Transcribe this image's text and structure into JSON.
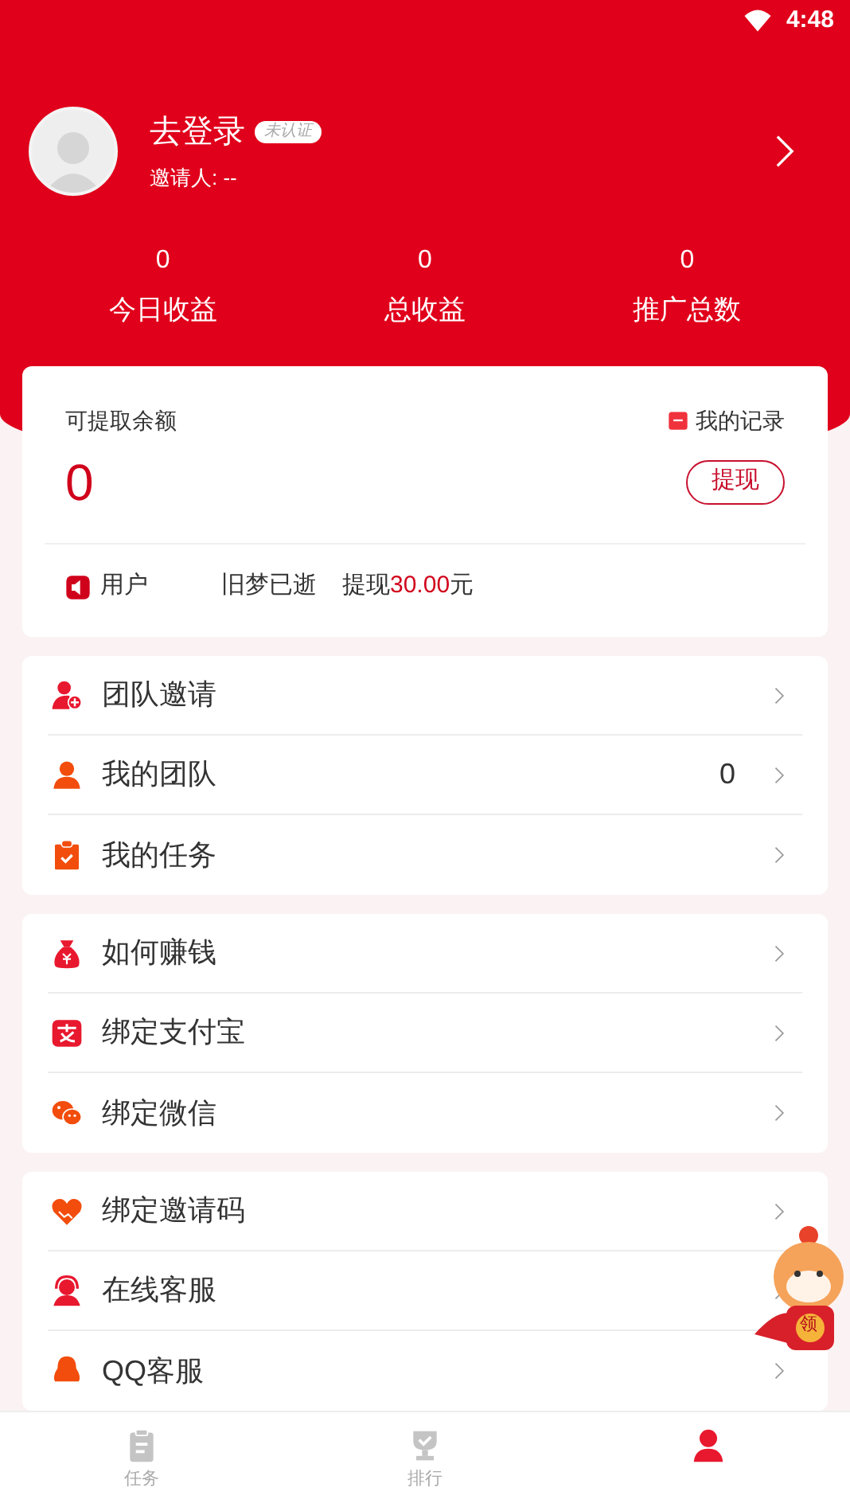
{
  "status_bar": {
    "time": "4:48"
  },
  "profile": {
    "name": "去登录",
    "badge": "未认证",
    "inviter": "邀请人: --"
  },
  "stats": [
    {
      "value": "0",
      "label": "今日收益"
    },
    {
      "value": "0",
      "label": "总收益"
    },
    {
      "value": "0",
      "label": "推广总数"
    }
  ],
  "balance_card": {
    "title": "可提取余额",
    "records_link": "我的记录",
    "amount": "0",
    "withdraw_button": "提现",
    "notice": {
      "user_label": "用户",
      "user_name": "旧梦已逝",
      "action": "提现",
      "amount": "30.00",
      "unit": "元"
    }
  },
  "menu_groups": [
    {
      "items": [
        {
          "kind": "invite",
          "label": "团队邀请"
        },
        {
          "kind": "team",
          "label": "我的团队",
          "count": "0"
        },
        {
          "kind": "tasks",
          "label": "我的任务"
        }
      ]
    },
    {
      "items": [
        {
          "kind": "money",
          "label": "如何赚钱"
        },
        {
          "kind": "alipay",
          "label": "绑定支付宝"
        },
        {
          "kind": "wechat",
          "label": "绑定微信"
        }
      ]
    },
    {
      "items": [
        {
          "kind": "code",
          "label": "绑定邀请码"
        },
        {
          "kind": "service",
          "label": "在线客服"
        },
        {
          "kind": "qq",
          "label": "QQ客服"
        }
      ]
    }
  ],
  "floating_badge": {
    "label": "领"
  },
  "tab_bar": [
    {
      "kind": "tasks",
      "label": "任务",
      "selected": false
    },
    {
      "kind": "rank",
      "label": "排行",
      "selected": false
    },
    {
      "kind": "me",
      "selected": true
    }
  ]
}
